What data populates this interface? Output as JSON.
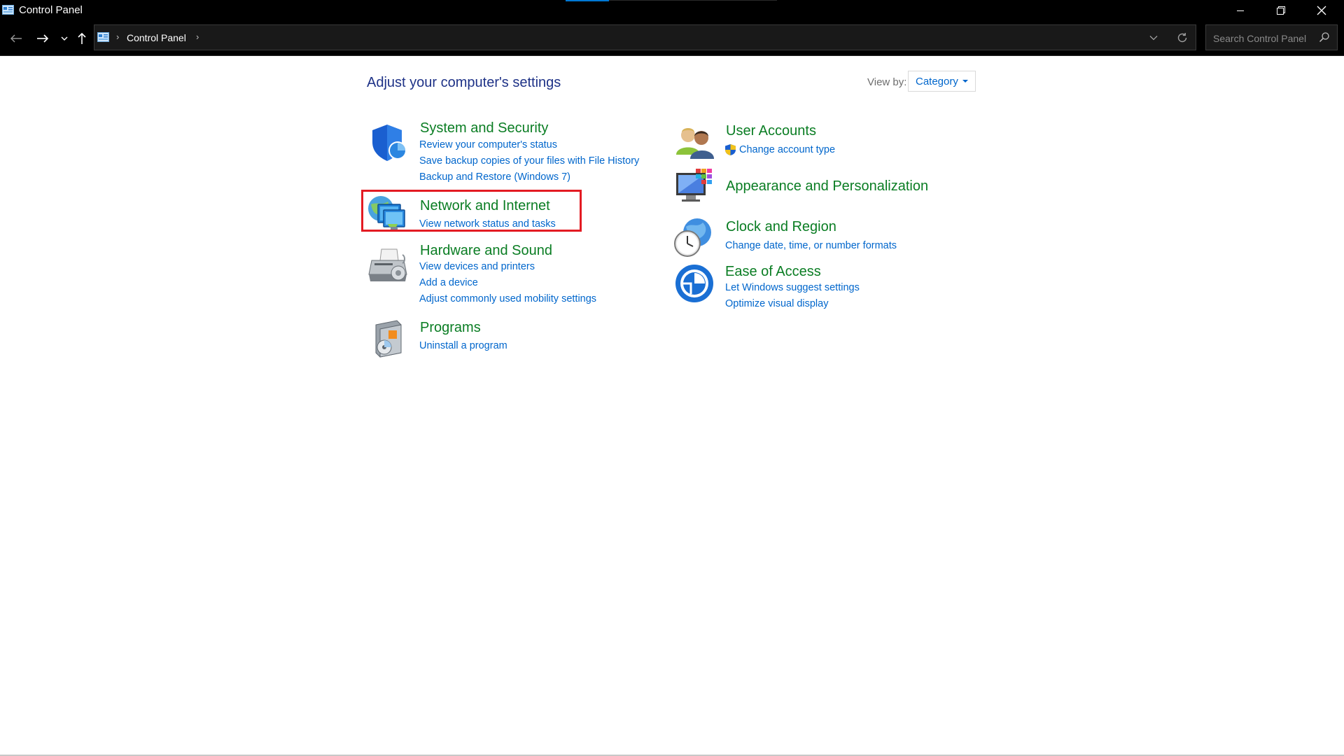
{
  "window": {
    "title": "Control Panel"
  },
  "navbar": {
    "breadcrumb": "Control Panel",
    "search_placeholder": "Search Control Panel"
  },
  "content": {
    "heading": "Adjust your computer's settings",
    "view_by_label": "View by:",
    "view_by_value": "Category"
  },
  "categories": {
    "system_security": {
      "title": "System and Security",
      "links": [
        "Review your computer's status",
        "Save backup copies of your files with File History",
        "Backup and Restore (Windows 7)"
      ]
    },
    "network_internet": {
      "title": "Network and Internet",
      "links": [
        "View network status and tasks"
      ]
    },
    "hardware_sound": {
      "title": "Hardware and Sound",
      "links": [
        "View devices and printers",
        "Add a device",
        "Adjust commonly used mobility settings"
      ]
    },
    "programs": {
      "title": "Programs",
      "links": [
        "Uninstall a program"
      ]
    },
    "user_accounts": {
      "title": "User Accounts",
      "links": [
        "Change account type"
      ]
    },
    "appearance": {
      "title": "Appearance and Personalization",
      "links": []
    },
    "clock_region": {
      "title": "Clock and Region",
      "links": [
        "Change date, time, or number formats"
      ]
    },
    "ease_access": {
      "title": "Ease of Access",
      "links": [
        "Let Windows suggest settings",
        "Optimize visual display"
      ]
    }
  },
  "colors": {
    "category_title": "#0a7d23",
    "link": "#0066cc",
    "heading": "#1e3287",
    "highlight": "#e31b23",
    "chrome": "#000000"
  },
  "icons": {
    "app": "control-panel-icon",
    "back": "arrow-left-icon",
    "forward": "arrow-right-icon",
    "recent": "chevron-down-icon",
    "up": "arrow-up-icon",
    "refresh": "refresh-icon",
    "search": "magnifier-icon",
    "minimize": "minimize-icon",
    "restore": "restore-icon",
    "close": "close-icon"
  }
}
